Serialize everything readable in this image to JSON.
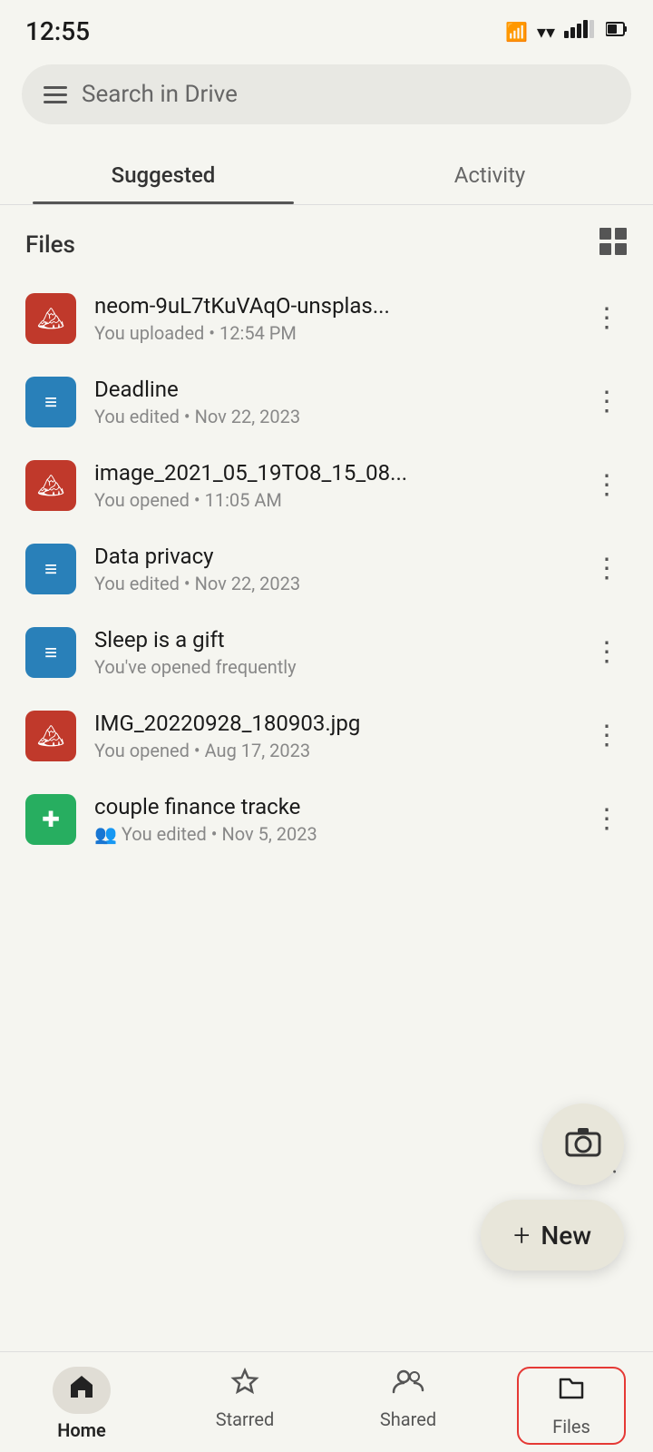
{
  "statusBar": {
    "time": "12:55"
  },
  "searchBar": {
    "placeholder": "Search in Drive"
  },
  "tabs": [
    {
      "id": "suggested",
      "label": "Suggested",
      "active": true
    },
    {
      "id": "activity",
      "label": "Activity",
      "active": false
    }
  ],
  "filesSection": {
    "title": "Files",
    "gridIconLabel": "grid-view"
  },
  "files": [
    {
      "id": 1,
      "name": "neom-9uL7tKuVAqO-unsplas...",
      "meta": "You uploaded • 12:54 PM",
      "type": "image"
    },
    {
      "id": 2,
      "name": "Deadline",
      "meta": "You edited • Nov 22, 2023",
      "type": "doc"
    },
    {
      "id": 3,
      "name": "image_2021_05_19TO8_15_08...",
      "meta": "You opened • 11:05 AM",
      "type": "image"
    },
    {
      "id": 4,
      "name": "Data privacy",
      "meta": "You edited • Nov 22, 2023",
      "type": "doc"
    },
    {
      "id": 5,
      "name": "Sleep is a gift",
      "meta": "You've opened frequently",
      "type": "doc"
    },
    {
      "id": 6,
      "name": "IMG_20220928_180903.jpg",
      "meta": "You opened • Aug 17, 2023",
      "type": "image"
    },
    {
      "id": 7,
      "name": "couple finance tracke",
      "meta": "You edited • Nov 5, 2023",
      "type": "sheet",
      "shared": true
    }
  ],
  "overlay": {
    "cameraLabel": "camera",
    "newLabel": "New",
    "newPlus": "+"
  },
  "bottomNav": [
    {
      "id": "home",
      "label": "Home",
      "icon": "🏠",
      "active": true
    },
    {
      "id": "starred",
      "label": "Starred",
      "icon": "☆",
      "active": false
    },
    {
      "id": "shared",
      "label": "Shared",
      "icon": "👥",
      "active": false
    },
    {
      "id": "files",
      "label": "Files",
      "icon": "🗂",
      "active": true,
      "highlighted": true
    }
  ]
}
